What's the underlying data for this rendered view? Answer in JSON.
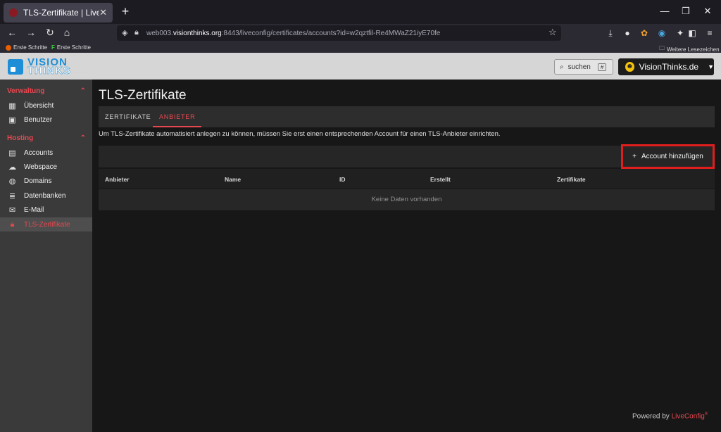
{
  "browser": {
    "tab_title": "TLS-Zertifikate | LiveConfig",
    "url_prefix": "web003.",
    "url_host": "visionthinks.org",
    "url_rest": ":8443/liveconfig/certificates/accounts?id=w2qztfil-Re4MWaZ21iyE70fe",
    "bookmarks": [
      "Erste Schritte",
      "Erste Schritte"
    ],
    "other_bookmarks": "Weitere Lesezeichen"
  },
  "header": {
    "logo_line1": "VISION",
    "logo_line2": "THINKS",
    "search_label": "suchen",
    "search_key": "#",
    "account_name": "VisionThinks.de"
  },
  "sidebar": {
    "section1": "Verwaltung",
    "section1_items": [
      {
        "label": "Übersicht",
        "icon": "dashboard-icon"
      },
      {
        "label": "Benutzer",
        "icon": "user-card-icon"
      }
    ],
    "section2": "Hosting",
    "section2_items": [
      {
        "label": "Accounts",
        "icon": "accounts-icon"
      },
      {
        "label": "Webspace",
        "icon": "cloud-icon"
      },
      {
        "label": "Domains",
        "icon": "globe-icon"
      },
      {
        "label": "Datenbanken",
        "icon": "database-icon"
      },
      {
        "label": "E-Mail",
        "icon": "mail-icon"
      },
      {
        "label": "TLS-Zertifikate",
        "icon": "lock-icon",
        "active": true
      }
    ]
  },
  "main": {
    "title": "TLS-Zertifikate",
    "tabs": [
      "ZERTIFIKATE",
      "ANBIETER"
    ],
    "info_text": "Um TLS-Zertifikate automatisiert anlegen zu können, müssen Sie erst einen entsprechenden Account für einen TLS-Anbieter einrichten.",
    "add_button": "Account hinzufügen",
    "table_headers": [
      "Anbieter",
      "Name",
      "ID",
      "Erstellt",
      "Zertifikate"
    ],
    "empty_text": "Keine Daten vorhanden"
  },
  "footer": {
    "powered_by": "Powered by",
    "brand": "LiveConfig",
    "reg": "®"
  },
  "colors": {
    "accent": "#e8474f",
    "highlight_border": "#e01e1e",
    "logo_blue": "#1e8fd6"
  }
}
